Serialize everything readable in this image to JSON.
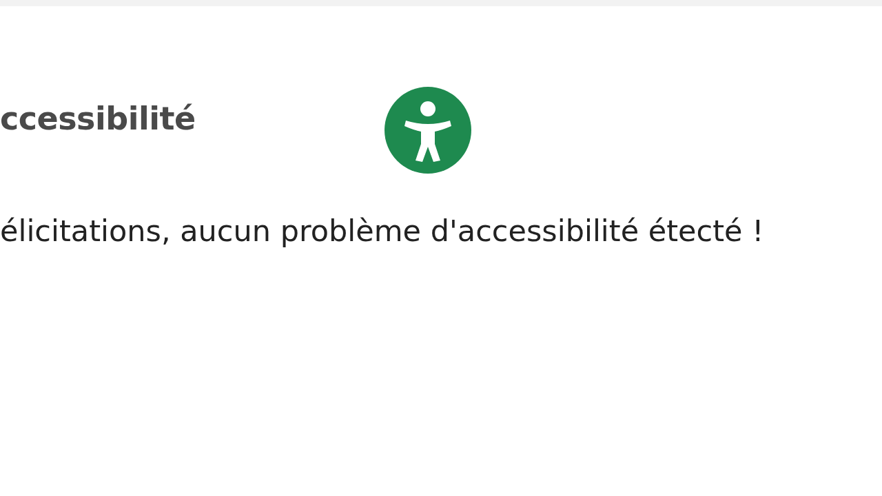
{
  "header": {
    "title": "ccessibilité"
  },
  "message": "élicitations, aucun problème d'accessibilité étecté !"
}
